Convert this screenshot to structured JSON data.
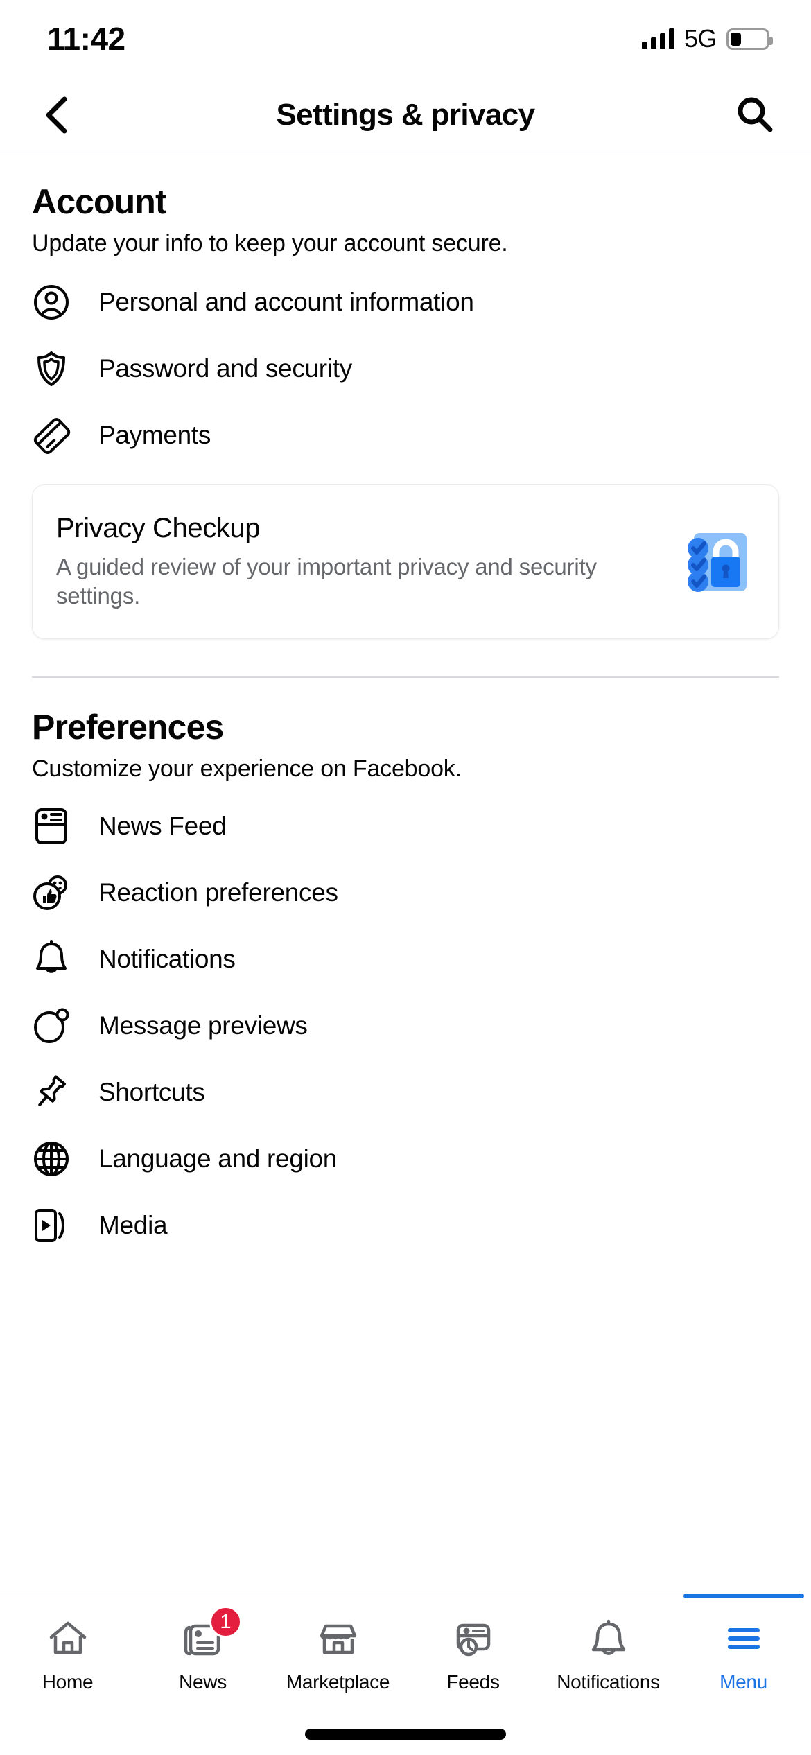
{
  "status_bar": {
    "time": "11:42",
    "network": "5G",
    "battery_percent": 30,
    "signal_icon": "signal-bars-icon",
    "battery_icon": "battery-icon"
  },
  "header": {
    "title": "Settings & privacy",
    "back_icon": "chevron-left-icon",
    "search_icon": "search-icon"
  },
  "account_section": {
    "title": "Account",
    "subtitle": "Update your info to keep your account secure.",
    "items": [
      {
        "label": "Personal and account information",
        "icon": "person-circle-icon"
      },
      {
        "label": "Password and security",
        "icon": "shield-icon"
      },
      {
        "label": "Payments",
        "icon": "credit-card-icon"
      }
    ]
  },
  "privacy_card": {
    "title": "Privacy Checkup",
    "subtitle": "A guided review of your important privacy and security settings.",
    "art_icon": "privacy-checklist-lock-icon",
    "colors": {
      "art_background": "#8CC0F8",
      "check_circle": "#2D7FF0",
      "lock_body": "#1877F2",
      "lock_shackle": "#FFFFFF"
    }
  },
  "preferences_section": {
    "title": "Preferences",
    "subtitle": "Customize your experience on Facebook.",
    "items": [
      {
        "label": "News Feed",
        "icon": "news-feed-icon"
      },
      {
        "label": "Reaction preferences",
        "icon": "reactions-icon"
      },
      {
        "label": "Notifications",
        "icon": "bell-icon"
      },
      {
        "label": "Message previews",
        "icon": "message-bubble-icon"
      },
      {
        "label": "Shortcuts",
        "icon": "pushpin-icon"
      },
      {
        "label": "Language and region",
        "icon": "globe-icon"
      },
      {
        "label": "Media",
        "icon": "media-play-icon"
      }
    ]
  },
  "tab_bar": {
    "active_tab": "Menu",
    "accent_color": "#1B74E4",
    "badge_color": "#E41E3F",
    "tabs": [
      {
        "label": "Home",
        "icon": "home-icon",
        "badge": "",
        "active": false
      },
      {
        "label": "News",
        "icon": "newspaper-icon",
        "badge": "1",
        "active": false
      },
      {
        "label": "Marketplace",
        "icon": "storefront-icon",
        "badge": "",
        "active": false
      },
      {
        "label": "Feeds",
        "icon": "feeds-clock-icon",
        "badge": "",
        "active": false
      },
      {
        "label": "Notifications",
        "icon": "bell-icon",
        "badge": "",
        "active": false
      },
      {
        "label": "Menu",
        "icon": "hamburger-menu-icon",
        "badge": "",
        "active": true
      }
    ]
  }
}
